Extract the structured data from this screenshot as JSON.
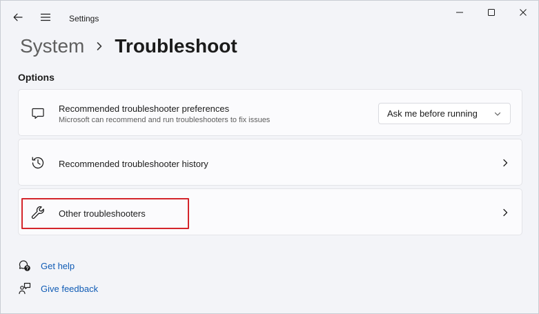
{
  "window": {
    "app_title": "Settings"
  },
  "breadcrumb": {
    "parent": "System",
    "separator": "›",
    "current": "Troubleshoot"
  },
  "options": {
    "section_title": "Options",
    "items": [
      {
        "icon": "chat-bubble-icon",
        "title": "Recommended troubleshooter preferences",
        "description": "Microsoft can recommend and run troubleshooters to fix issues",
        "dropdown_value": "Ask me before running"
      },
      {
        "icon": "history-icon",
        "title": "Recommended troubleshooter history"
      },
      {
        "icon": "wrench-icon",
        "title": "Other troubleshooters"
      }
    ]
  },
  "links": {
    "get_help": "Get help",
    "give_feedback": "Give feedback"
  },
  "colors": {
    "accent_link": "#0f5bb5",
    "highlight_box": "#d4242a"
  }
}
